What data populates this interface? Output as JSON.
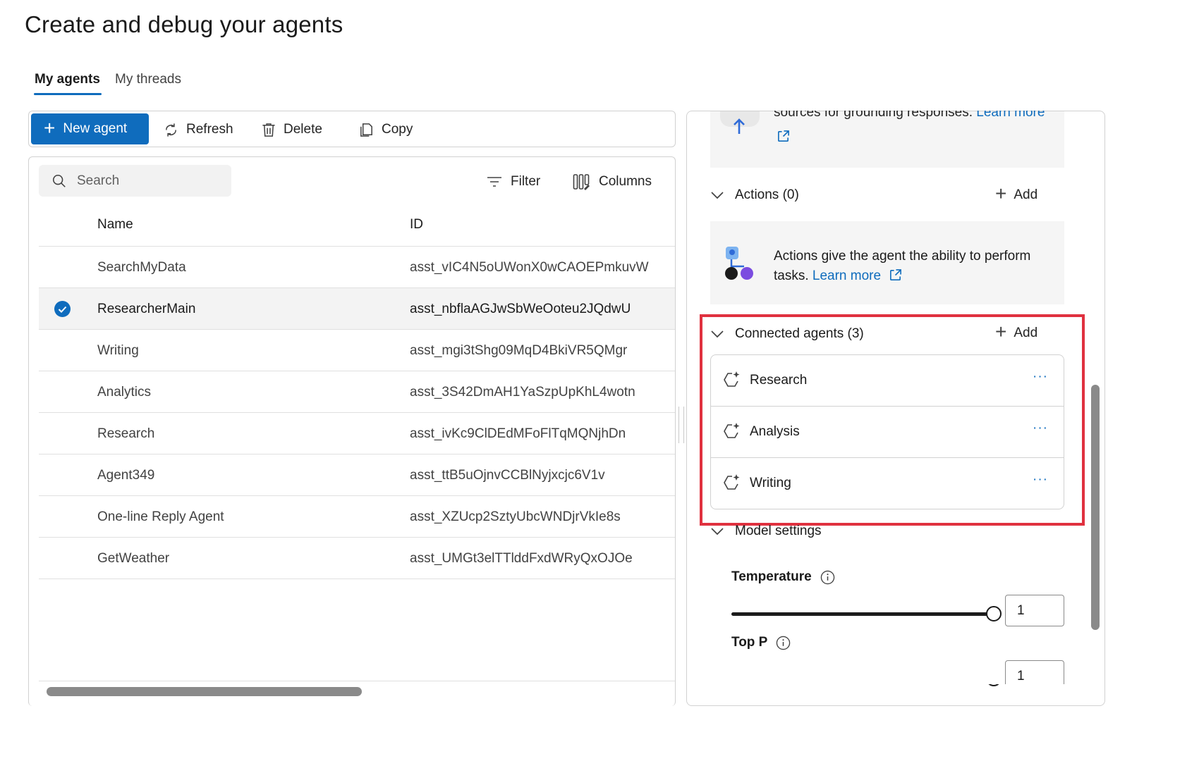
{
  "page": {
    "title": "Create and debug your agents"
  },
  "tabs": [
    {
      "label": "My agents",
      "active": true
    },
    {
      "label": "My threads",
      "active": false
    }
  ],
  "toolbar": {
    "new_agent": "New agent",
    "refresh": "Refresh",
    "delete": "Delete",
    "copy": "Copy"
  },
  "table": {
    "search_placeholder": "Search",
    "filter": "Filter",
    "columns_button": "Columns",
    "headers": {
      "name": "Name",
      "id": "ID"
    },
    "rows": [
      {
        "name": "SearchMyData",
        "id": "asst_vIC4N5oUWonX0wCAOEPmkuvW",
        "selected": false
      },
      {
        "name": "ResearcherMain",
        "id": "asst_nbflaAGJwSbWeOoteu2JQdwU",
        "selected": true
      },
      {
        "name": "Writing",
        "id": "asst_mgi3tShg09MqD4BkiVR5QMgr",
        "selected": false
      },
      {
        "name": "Analytics",
        "id": "asst_3S42DmAH1YaSzpUpKhL4wotn",
        "selected": false
      },
      {
        "name": "Research",
        "id": "asst_ivKc9ClDEdMFoFlTqMQNjhDn",
        "selected": false
      },
      {
        "name": "Agent349",
        "id": "asst_ttB5uOjnvCCBlNyjxcjc6V1v",
        "selected": false
      },
      {
        "name": "One-line Reply Agent",
        "id": "asst_XZUcp2SztyUbcWNDjrVkIe8s",
        "selected": false
      },
      {
        "name": "GetWeather",
        "id": "asst_UMGt3elTTlddFxdWRyQxOJOe",
        "selected": false
      }
    ]
  },
  "right_panel": {
    "knowledge": {
      "text_partial": "sources for grounding responses.",
      "learn_more": "Learn more"
    },
    "actions": {
      "title": "Actions (0)",
      "add": "Add",
      "description": "Actions give the agent the ability to perform tasks.",
      "learn_more": "Learn more"
    },
    "connected_agents": {
      "title": "Connected agents (3)",
      "add": "Add",
      "items": [
        {
          "name": "Research",
          "more": "···"
        },
        {
          "name": "Analysis",
          "more": "···"
        },
        {
          "name": "Writing",
          "more": "···"
        }
      ]
    },
    "model_settings": {
      "title": "Model settings",
      "temperature": {
        "label": "Temperature",
        "value": "1",
        "slider_fraction": 1.0
      },
      "top_p": {
        "label": "Top P",
        "value": "1",
        "slider_fraction": 1.0
      }
    }
  },
  "colors": {
    "accent": "#0f6cbd",
    "highlight": "#e0313f",
    "selected_row": "#f3f3f3"
  },
  "icons": {
    "new_agent": "plus-icon",
    "refresh": "refresh-icon",
    "delete": "trash-icon",
    "copy": "copy-icon",
    "search": "search-icon",
    "filter": "filter-icon",
    "columns": "columns-icon",
    "selected_row": "checkmark-circle-icon",
    "external_link": "external-link-icon",
    "collapse": "chevron-down-icon",
    "agent": "sparkle-agent-icon",
    "info": "info-icon"
  }
}
